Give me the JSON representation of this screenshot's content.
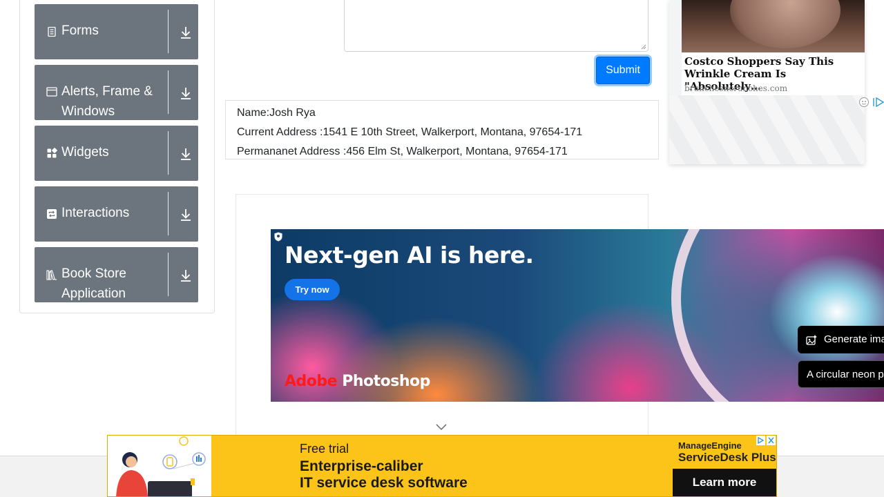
{
  "sidebar": {
    "groups": [
      {
        "label": "Forms",
        "icon": "document-icon"
      },
      {
        "label": "Alerts, Frame & Windows",
        "icon": "window-icon"
      },
      {
        "label": "Widgets",
        "icon": "widgets-icon"
      },
      {
        "label": "Interactions",
        "icon": "interactions-icon"
      },
      {
        "label": "Book Store Application",
        "icon": "books-icon"
      }
    ]
  },
  "form": {
    "submit_label": "Submit"
  },
  "output": {
    "name": "Name:Josh Rya",
    "current_address": "Current Address :1541 E 10th Street, Walkerport, Montana, 97654-171",
    "permanent_address": "Permananet Address :456 Elm St, Walkerport, Montana, 97654-171"
  },
  "side_ad": {
    "headline": "Costco Shoppers Say This Wrinkle Cream Is \"Absolutely…",
    "source": "brunchesncrunches.com"
  },
  "photoshop_ad": {
    "title": "Next-gen AI is here.",
    "cta": "Try now",
    "brand_adobe": "Adobe",
    "brand_product": "Photoshop",
    "pill_1": "Generate ima",
    "pill_2": "A circular neon p"
  },
  "bottom_ad": {
    "line1": "Free trial",
    "line2": "Enterprise-caliber",
    "line3": "IT service desk software",
    "brand_top": "ManageEngine",
    "brand_product": "ServiceDesk Plus",
    "cta": "Learn more"
  },
  "colors": {
    "sidebar_group_bg": "#6c757d",
    "submit_bg": "#007bff",
    "bottom_ad_bg": "#fcc419",
    "adobe_red": "#ff1a1a"
  }
}
